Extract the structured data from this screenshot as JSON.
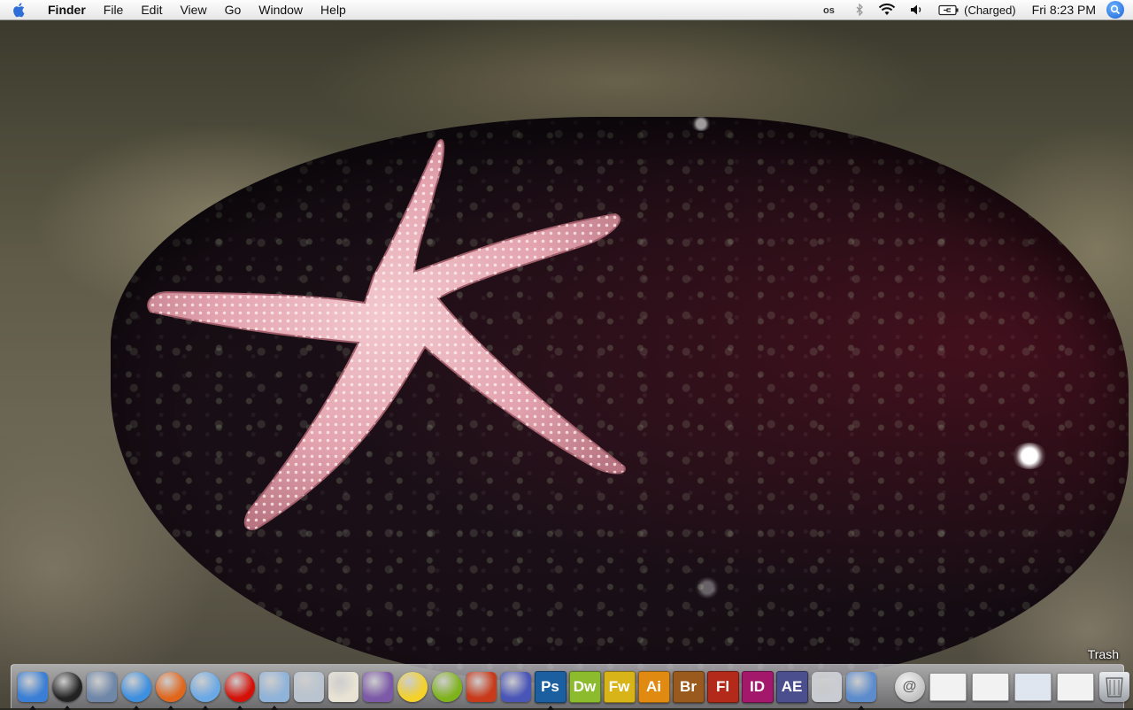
{
  "menubar": {
    "app_name": "Finder",
    "menus": [
      "File",
      "Edit",
      "View",
      "Go",
      "Window",
      "Help"
    ],
    "status": {
      "battery_text": "(Charged)",
      "clock": "Fri 8:23 PM"
    }
  },
  "dock": {
    "trash_label": "Trash",
    "apps": [
      {
        "name": "finder-icon",
        "color": "#3a7fd5",
        "running": true
      },
      {
        "name": "dashboard-icon",
        "color": "#222222",
        "running": true
      },
      {
        "name": "mail-icon",
        "color": "#6f87a8",
        "running": false
      },
      {
        "name": "safari-icon",
        "color": "#3d8fe0",
        "running": true
      },
      {
        "name": "firefox-icon",
        "color": "#e0661c",
        "running": true
      },
      {
        "name": "itunes-icon",
        "color": "#6aa9e6",
        "running": true
      },
      {
        "name": "lastfm-icon",
        "color": "#d51007",
        "running": true
      },
      {
        "name": "preview-icon",
        "color": "#8fb3d9",
        "running": true
      },
      {
        "name": "iphoto-icon",
        "color": "#b9c4d0",
        "running": false
      },
      {
        "name": "textedit-icon",
        "color": "#e8e3d4",
        "running": false
      },
      {
        "name": "bridge-utility-icon",
        "color": "#7d5aa8",
        "running": false
      },
      {
        "name": "cyberduck-icon",
        "color": "#f4d22a",
        "running": false
      },
      {
        "name": "spiral-app-icon",
        "color": "#7fb31c",
        "running": false
      },
      {
        "name": "sun-app-icon",
        "color": "#c83a1a",
        "running": false
      },
      {
        "name": "burst-app-icon",
        "color": "#4a55b8",
        "running": false
      }
    ],
    "adobe": [
      {
        "label": "Ps",
        "name": "photoshop-icon",
        "color": "#1b5fa0",
        "running": true
      },
      {
        "label": "Dw",
        "name": "dreamweaver-icon",
        "color": "#8cbc2d",
        "running": false
      },
      {
        "label": "Fw",
        "name": "fireworks-icon",
        "color": "#d9b419",
        "running": false
      },
      {
        "label": "Ai",
        "name": "illustrator-icon",
        "color": "#e08a12",
        "running": false
      },
      {
        "label": "Br",
        "name": "bridge-icon",
        "color": "#9a5a1e",
        "running": false
      },
      {
        "label": "Fl",
        "name": "flash-icon",
        "color": "#b32a1a",
        "running": false
      },
      {
        "label": "ID",
        "name": "indesign-icon",
        "color": "#a3186a",
        "running": false
      },
      {
        "label": "AE",
        "name": "after-effects-icon",
        "color": "#4c4f8e",
        "running": false
      }
    ],
    "tail_apps": [
      {
        "name": "script-editor-icon",
        "color": "#c9ccd2",
        "running": false
      },
      {
        "name": "photo-tool-icon",
        "color": "#5c8ccc",
        "running": true
      }
    ]
  }
}
